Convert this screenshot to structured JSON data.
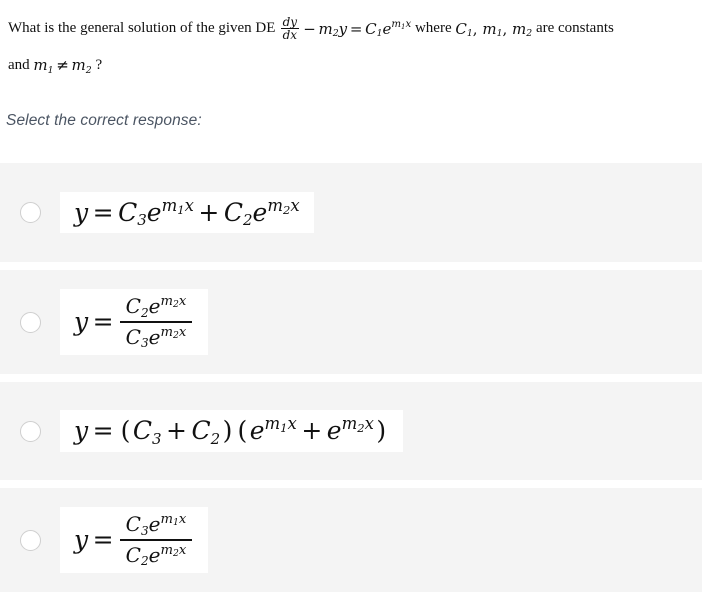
{
  "question": {
    "line1_part1": "What is the general solution of the given DE",
    "math": {
      "frac_num": "dy",
      "frac_den": "dx",
      "minus": "−",
      "m2y": "m2y",
      "equals": "=",
      "rhs": "C1e^(m1x)"
    },
    "line1_part2": "where",
    "constants": "C1, m1, m2",
    "line1_part3": "are constants",
    "line2_prefix": "and",
    "line2_math": "m1 ≠ m2",
    "line2_suffix": "?"
  },
  "prompt": "Select the correct response:",
  "symbols": {
    "y": "y",
    "equals": "=",
    "plus": "+",
    "minus": "−",
    "neq": "≠",
    "e": "e",
    "x": "x",
    "m": "m",
    "C": "C",
    "d": "d",
    "lparen": "(",
    "rparen": ")",
    "qmark": "?",
    "comma": ",",
    "sub1": "1",
    "sub2": "2",
    "sub3": "3"
  },
  "options": [
    {
      "id": "option-a",
      "selected": false,
      "latex": "y = C_3 e^{m_1 x} + C_2 e^{m_2 x}",
      "plain": "y = C3e^(m1x) + C2e^(m2x)",
      "layout": "inline"
    },
    {
      "id": "option-b",
      "selected": false,
      "latex": "y = \\frac{C_2 e^{m_2 x}}{C_3 e^{m_2 x}}",
      "plain": "y = C2e^(m2x) / C3e^(m2x)",
      "layout": "fraction",
      "numerator": "C2e^(m2x)",
      "denominator": "C3e^(m2x)"
    },
    {
      "id": "option-c",
      "selected": false,
      "latex": "y = (C_3 + C_2)(e^{m_1 x} + e^{m_2 x})",
      "plain": "y = (C3 + C2)(e^(m1x) + e^(m2x))",
      "layout": "inline"
    },
    {
      "id": "option-d",
      "selected": false,
      "latex": "y = \\frac{C_3 e^{m_1 x}}{C_2 e^{m_2 x}}",
      "plain": "y = C3e^(m1x) / C2e^(m2x)",
      "layout": "fraction",
      "numerator": "C3e^(m1x)",
      "denominator": "C2e^(m2x)"
    }
  ],
  "colors": {
    "page_background": "#ffffff",
    "option_row_background": "#f4f4f4",
    "formula_box_background": "#ffffff",
    "radio_border": "#cfcfcf",
    "text": "#111111",
    "prompt_text": "#4b5563"
  }
}
